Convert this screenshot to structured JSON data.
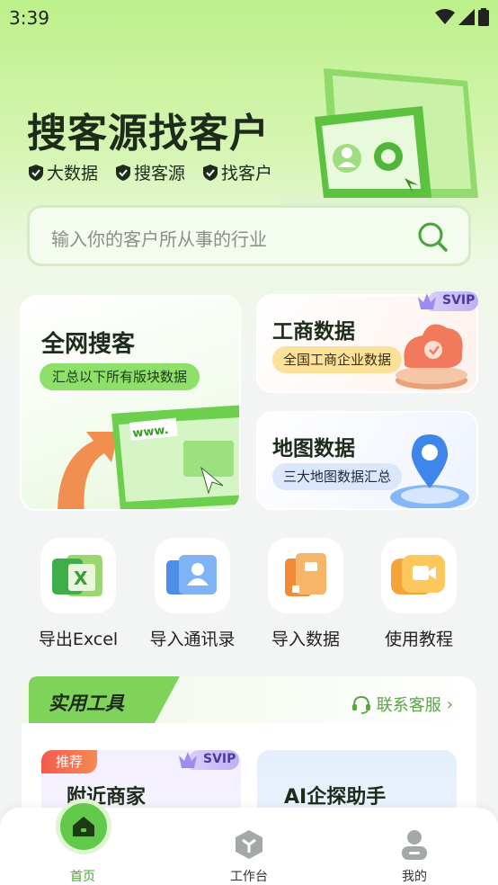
{
  "status_bar": {
    "time": "3:39"
  },
  "hero": {
    "title": "搜客源找客户",
    "tags": [
      "大数据",
      "搜客源",
      "找客户"
    ]
  },
  "search": {
    "placeholder": "输入你的客户所从事的行业"
  },
  "cards": {
    "all_web": {
      "title": "全网搜客",
      "subtitle": "汇总以下所有版块数据",
      "illus_text": "www."
    },
    "business": {
      "title": "工商数据",
      "subtitle": "全国工商企业数据",
      "badge": "SVIP"
    },
    "map": {
      "title": "地图数据",
      "subtitle": "三大地图数据汇总"
    }
  },
  "quick_actions": [
    {
      "label": "导出Excel",
      "icon": "excel-icon"
    },
    {
      "label": "导入通讯录",
      "icon": "contacts-icon"
    },
    {
      "label": "导入数据",
      "icon": "import-data-icon"
    },
    {
      "label": "使用教程",
      "icon": "video-tutorial-icon"
    }
  ],
  "tools": {
    "title": "实用工具",
    "contact": "联系客服",
    "items": [
      {
        "title": "附近商家",
        "tag": "推荐",
        "badge": "SVIP"
      },
      {
        "title": "AI企探助手"
      }
    ]
  },
  "bottom_nav": [
    {
      "label": "首页",
      "active": true
    },
    {
      "label": "工作台",
      "active": false
    },
    {
      "label": "我的",
      "active": false
    }
  ],
  "colors": {
    "accent": "#63c94a",
    "accent_text": "#4da437"
  }
}
